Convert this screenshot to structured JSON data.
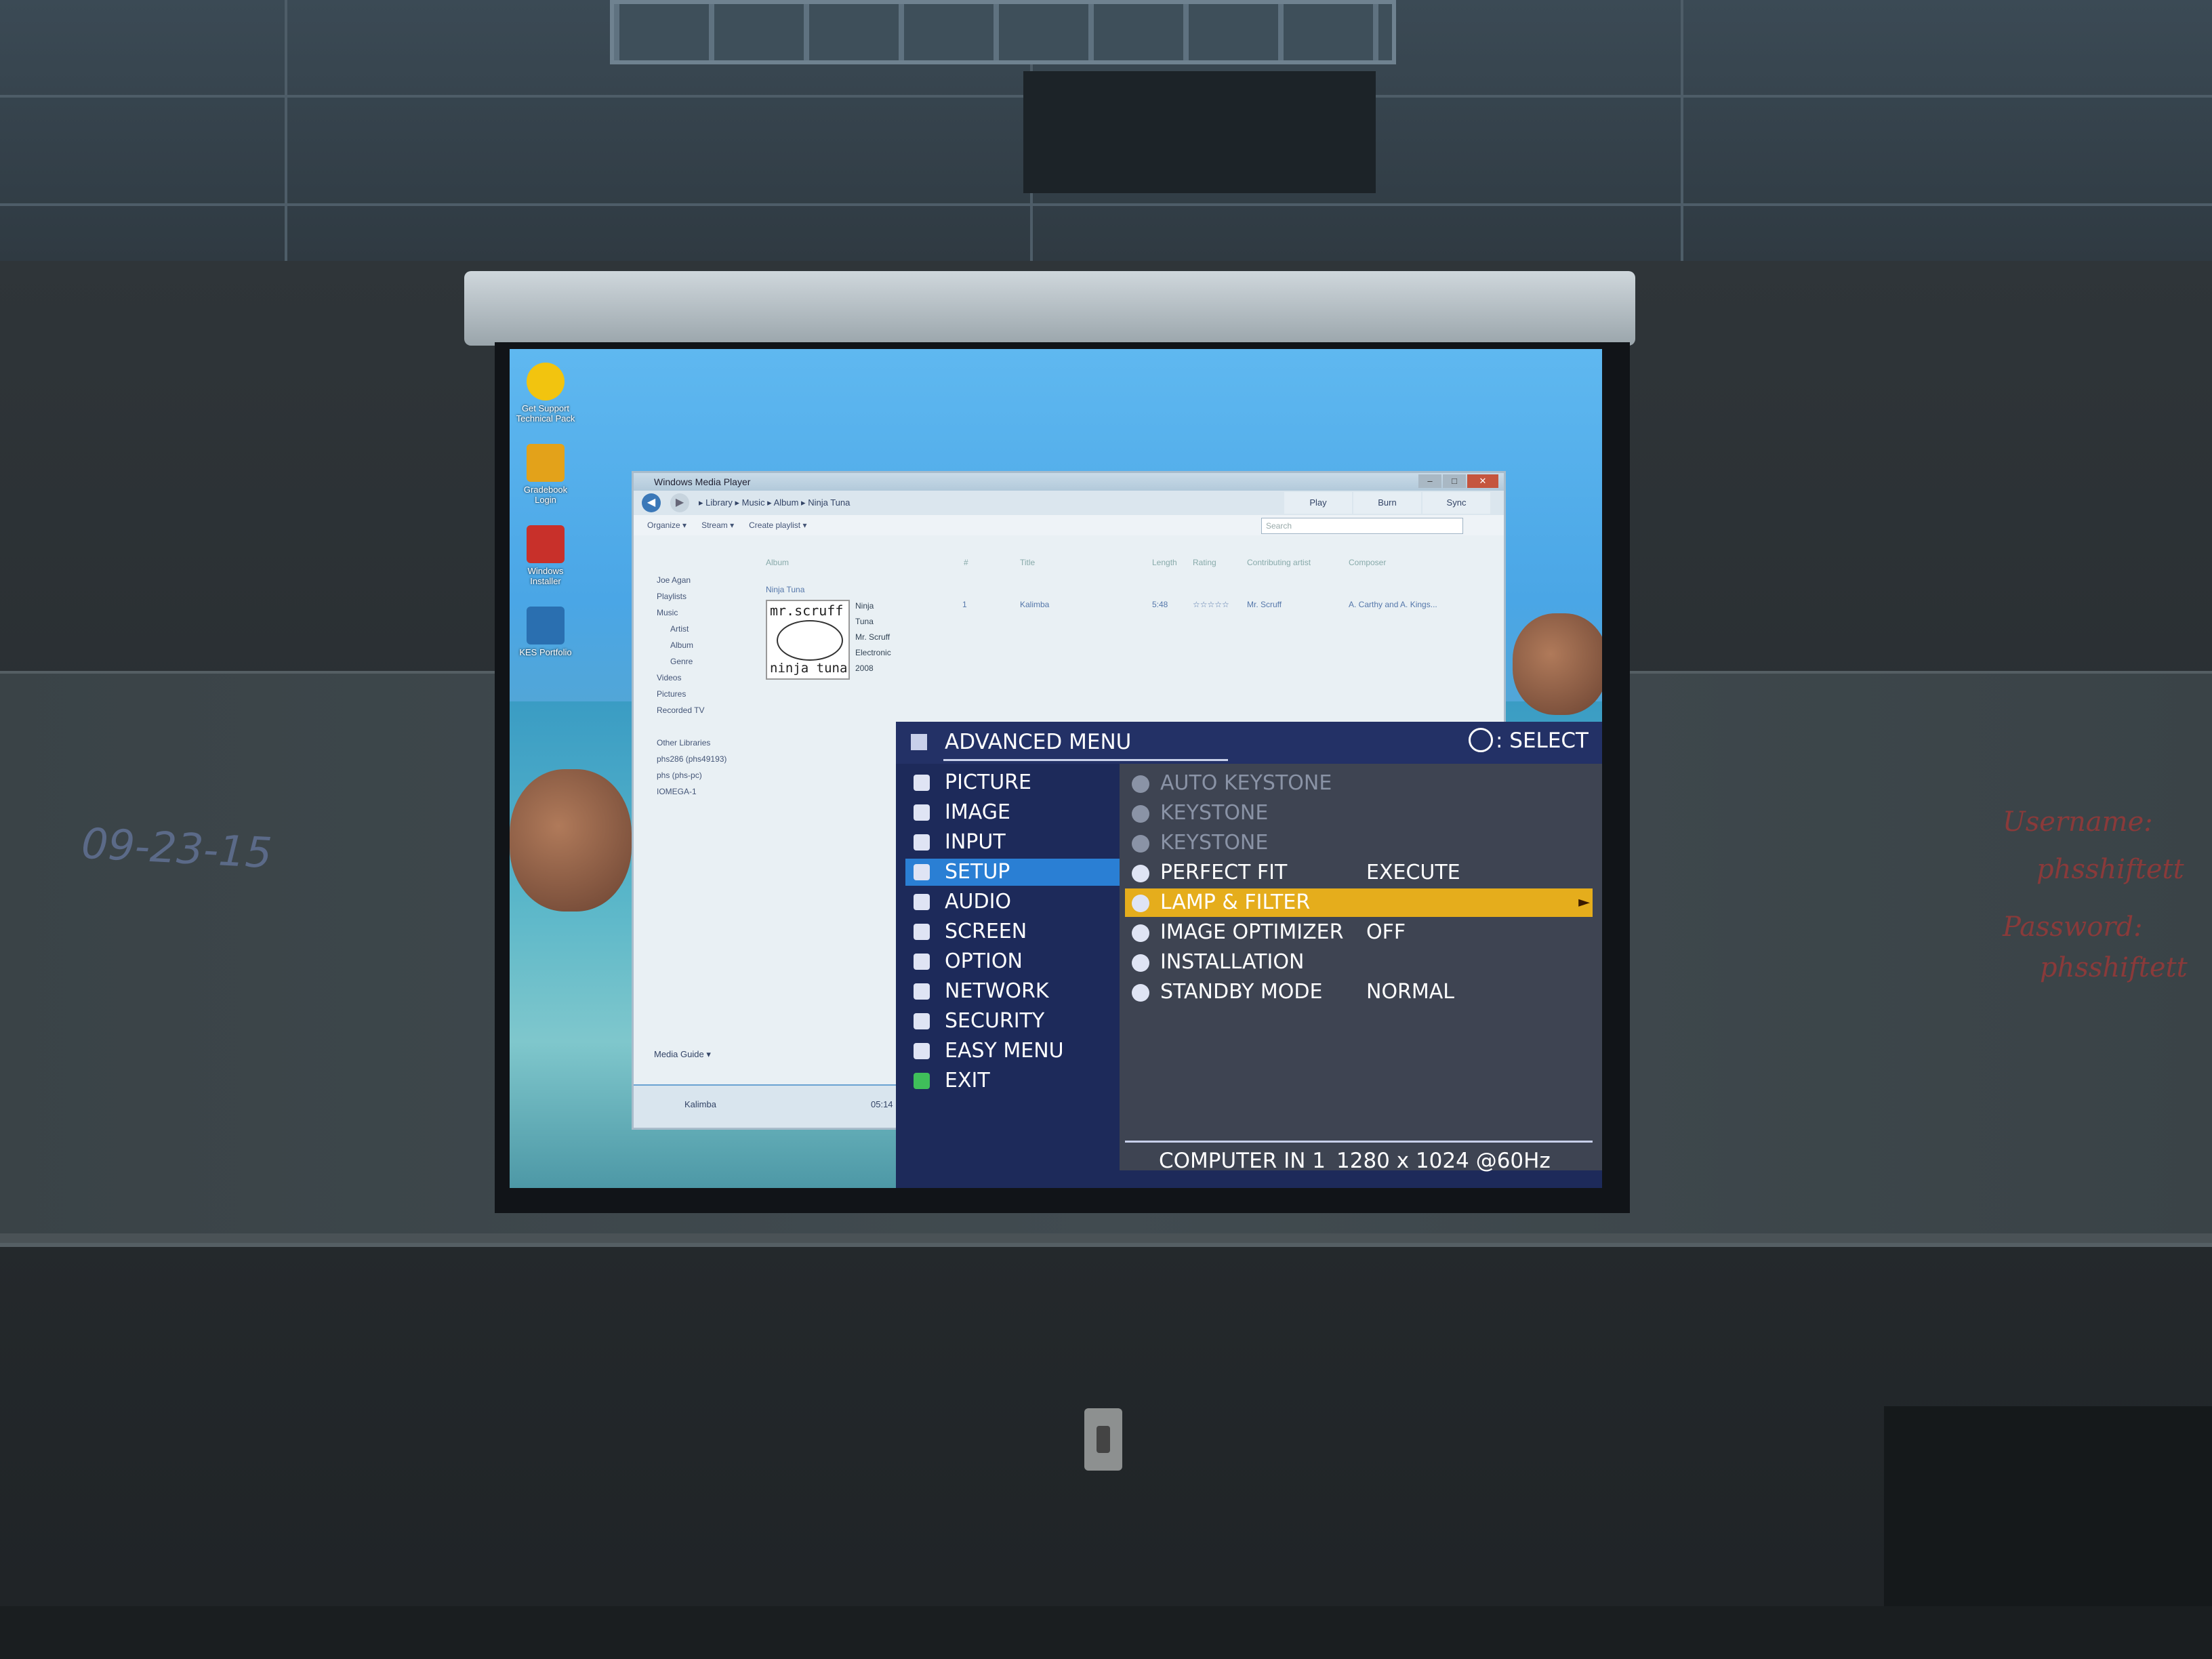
{
  "projector_menu": {
    "title": "ADVANCED MENU",
    "select_hint": ": SELECT",
    "categories": [
      {
        "label": "PICTURE",
        "icon": "sun-icon"
      },
      {
        "label": "IMAGE",
        "icon": "image-icon"
      },
      {
        "label": "INPUT",
        "icon": "input-icon"
      },
      {
        "label": "SETUP",
        "icon": "setup-icon",
        "active": true
      },
      {
        "label": "AUDIO",
        "icon": "note-icon"
      },
      {
        "label": "SCREEN",
        "icon": "screen-icon"
      },
      {
        "label": "OPTION",
        "icon": "option-icon"
      },
      {
        "label": "NETWORK",
        "icon": "network-icon"
      },
      {
        "label": "SECURITY",
        "icon": "shield-icon"
      },
      {
        "label": "EASY MENU",
        "icon": "menu-icon"
      },
      {
        "label": "EXIT",
        "icon": "exit-icon"
      }
    ],
    "setup_items": [
      {
        "label": "AUTO KEYSTONE",
        "value": "",
        "disabled": true
      },
      {
        "label": "KEYSTONE",
        "value": "",
        "disabled": true
      },
      {
        "label": "KEYSTONE",
        "value": "",
        "disabled": true
      },
      {
        "label": "PERFECT FIT",
        "value": "EXECUTE"
      },
      {
        "label": "LAMP & FILTER",
        "value": "",
        "highlighted": true,
        "arrow": "►"
      },
      {
        "label": "IMAGE OPTIMIZER",
        "value": "OFF"
      },
      {
        "label": "INSTALLATION",
        "value": ""
      },
      {
        "label": "STANDBY MODE",
        "value": "NORMAL"
      }
    ],
    "status_source": "COMPUTER IN 1",
    "status_resolution": "1280 x 1024 @60Hz",
    "colors": {
      "highlight": "#e5ad1c",
      "active": "#2a7fd4",
      "panel": "#1d2a5a"
    }
  },
  "wmp": {
    "window_title": "Windows Media Player",
    "win_buttons": [
      "–",
      "□",
      "✕"
    ],
    "breadcrumb": "▸ Library ▸ Music ▸ Album ▸ Ninja Tuna",
    "tabs": [
      "Play",
      "Burn",
      "Sync"
    ],
    "toolbar": [
      "Organize ▾",
      "Stream ▾",
      "Create playlist ▾"
    ],
    "search_placeholder": "Search",
    "columns": {
      "album": "Album",
      "num": "#",
      "title": "Title",
      "length": "Length",
      "rating": "Rating",
      "contrib": "Contributing artist",
      "composer": "Composer"
    },
    "sidebar": [
      "Joe Agan",
      "Playlists",
      "Music",
      "Artist",
      "Album",
      "Genre",
      "Videos",
      "Pictures",
      "Recorded TV",
      "",
      "Other Libraries",
      "phs286 (phs49193)",
      "phs (phs-pc)",
      "IOMEGA-1"
    ],
    "album": {
      "heading": "Ninja Tuna",
      "art_top": "mr.scruff",
      "art_bottom": "ninja tuna",
      "info": [
        "Ninja Tuna",
        "Mr. Scruff",
        "Electronic",
        "2008"
      ]
    },
    "track": {
      "num": "1",
      "title": "Kalimba",
      "length": "5:48",
      "rating": "☆☆☆☆☆",
      "artist": "Mr. Scruff",
      "composer": "A. Carthy and A. Kings..."
    },
    "media_guide": "Media Guide ▾",
    "now_playing": "Kalimba",
    "now_time": "05:14"
  },
  "desktop_icons": [
    "Get Support Technical Pack",
    "Gradebook Login",
    "Windows Installer",
    "KES Portfolio"
  ],
  "whiteboard": {
    "date": "09-23-15",
    "notes": [
      "Username:",
      "phsshiftett",
      "Password:",
      "phsshiftett"
    ]
  }
}
